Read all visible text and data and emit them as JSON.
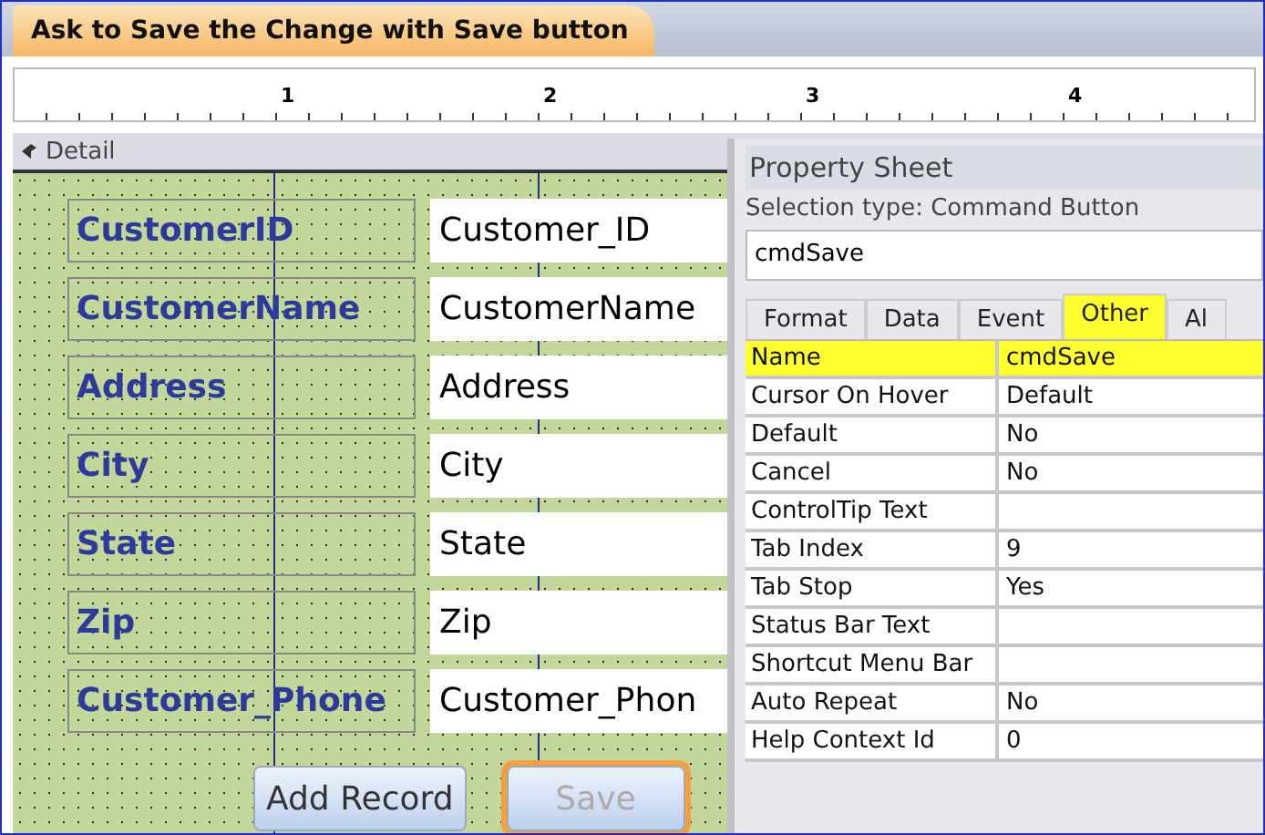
{
  "document_tab": {
    "title": "Ask to Save the Change with Save button"
  },
  "ruler": {
    "marks": [
      "1",
      "2",
      "3",
      "4"
    ]
  },
  "section": {
    "title": "Detail"
  },
  "fields": [
    {
      "label": "CustomerID",
      "value": "Customer_ID"
    },
    {
      "label": "CustomerName",
      "value": "CustomerName"
    },
    {
      "label": "Address",
      "value": "Address"
    },
    {
      "label": "City",
      "value": "City"
    },
    {
      "label": "State",
      "value": "State"
    },
    {
      "label": "Zip",
      "value": "Zip"
    },
    {
      "label": "Customer_Phone",
      "value": "Customer_Phon"
    }
  ],
  "buttons": [
    {
      "label": "Add Record",
      "selected": false
    },
    {
      "label": "Save",
      "selected": true
    }
  ],
  "property_sheet": {
    "title": "Property Sheet",
    "selection_type": "Selection type:  Command Button",
    "object": "cmdSave",
    "tabs": [
      {
        "label": "Format",
        "selected": false,
        "highlighted": false
      },
      {
        "label": "Data",
        "selected": false,
        "highlighted": false
      },
      {
        "label": "Event",
        "selected": false,
        "highlighted": false
      },
      {
        "label": "Other",
        "selected": true,
        "highlighted": true
      },
      {
        "label": "Al",
        "selected": false,
        "highlighted": false
      }
    ],
    "rows": [
      {
        "name": "Name",
        "value": "cmdSave",
        "highlighted": true
      },
      {
        "name": "Cursor On Hover",
        "value": "Default",
        "highlighted": false
      },
      {
        "name": "Default",
        "value": "No",
        "highlighted": false
      },
      {
        "name": "Cancel",
        "value": "No",
        "highlighted": false
      },
      {
        "name": "ControlTip Text",
        "value": "",
        "highlighted": false
      },
      {
        "name": "Tab Index",
        "value": "9",
        "highlighted": false
      },
      {
        "name": "Tab Stop",
        "value": "Yes",
        "highlighted": false
      },
      {
        "name": "Status Bar Text",
        "value": "",
        "highlighted": false
      },
      {
        "name": "Shortcut Menu Bar",
        "value": "",
        "highlighted": false
      },
      {
        "name": "Auto Repeat",
        "value": "No",
        "highlighted": false
      },
      {
        "name": "Help Context Id",
        "value": "0",
        "highlighted": false
      }
    ]
  }
}
